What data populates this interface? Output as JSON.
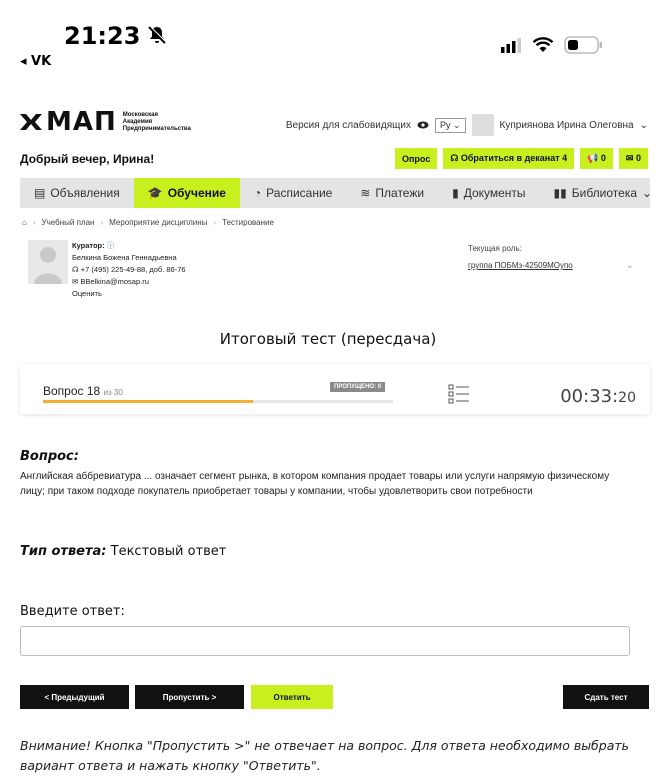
{
  "status_bar": {
    "time": "21:23",
    "back_app": "◂ VK"
  },
  "header": {
    "logo_text": "МАП",
    "logo_subtitle": [
      "Московская",
      "Академия",
      "Предпринимательства"
    ],
    "version_for_impaired": "Версия для слабовидящих",
    "language": "Ру",
    "user_name": "Куприянова Ирина Олеговна",
    "greeting": "Добрый вечер, Ирина!",
    "buttons": {
      "survey": "Опрос",
      "contact_dean": "Обратиться в деканат 4",
      "notifications_count": "0",
      "messages_count": "0"
    }
  },
  "nav": {
    "items": [
      {
        "label": "Объявления",
        "icon": "news-icon",
        "active": false
      },
      {
        "label": "Обучение",
        "icon": "graduation-cap-icon",
        "active": true
      },
      {
        "label": "Расписание",
        "icon": "clock-icon",
        "active": false
      },
      {
        "label": "Платежи",
        "icon": "coins-icon",
        "active": false
      },
      {
        "label": "Документы",
        "icon": "document-icon",
        "active": false
      },
      {
        "label": "Библиотека",
        "icon": "book-icon",
        "active": false
      }
    ]
  },
  "breadcrumb": [
    "Учебный план",
    "Мероприятие дисциплины",
    "Тестирование"
  ],
  "curator": {
    "title": "Куратор:",
    "name": "Белкина Божена Геннадьевна",
    "phone": "+7 (495) 225-49-88, доб. 86-76",
    "email": "BBelkina@mosap.ru",
    "rate": "Оценить"
  },
  "role": {
    "label": "Текущая роль:",
    "value": "группа ПОБМз-42509МОупо"
  },
  "test": {
    "title": "Итоговый тест (пересдача)",
    "question_label": "Вопрос 18",
    "question_of": "из 30",
    "skipped_badge": "ПРОПУЩЕНО: 0",
    "progress": 0.6,
    "timer_main": "00:33:",
    "timer_sec": "20"
  },
  "question": {
    "heading": "Вопрос:",
    "text": "Английская аббревиатура ... означает сегмент рынка, в котором компания продает товары или услуги напрямую физическому лицу; при таком подходе покупатель приобретает товары у компании, чтобы удовлетворить свои потребности",
    "answer_type_label": "Тип ответа:",
    "answer_type_value": "Текстовый ответ",
    "input_label": "Введите ответ:",
    "input_value": ""
  },
  "actions": {
    "prev": "< Предыдущий",
    "skip": "Пропустить >",
    "answer": "Ответить",
    "finish": "Сдать тест"
  },
  "notice": "Внимание! Кнопка \"Пропустить >\" не отвечает на вопрос. Для ответа необходимо выбрать вариант ответа и нажать кнопку \"Ответить\"."
}
